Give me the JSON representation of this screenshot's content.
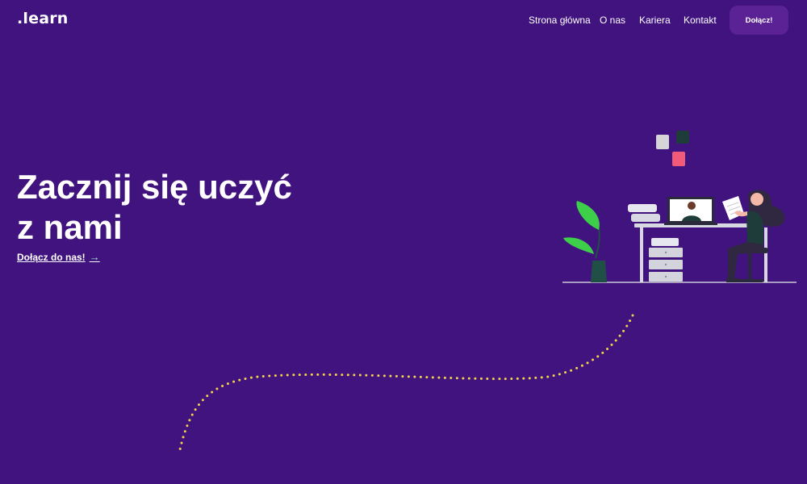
{
  "header": {
    "logo": ".learn",
    "nav": [
      {
        "label": "Strona główna"
      },
      {
        "label": "O nas"
      },
      {
        "label": "Kariera"
      },
      {
        "label": "Kontakt"
      }
    ],
    "join_button": "Dołącz!"
  },
  "hero": {
    "title_line1": "Zacznij się uczyć",
    "title_line2": "z nami",
    "cta_label": "Dołącz do nas!",
    "cta_arrow": "→"
  },
  "icons": {
    "cta_arrow": "arrow-right-icon"
  },
  "colors": {
    "background": "#41137f",
    "button_bg": "#5b2296",
    "dots": "#f3d34a",
    "accent_green": "#3ecf4a",
    "accent_pink": "#f25a7a"
  }
}
